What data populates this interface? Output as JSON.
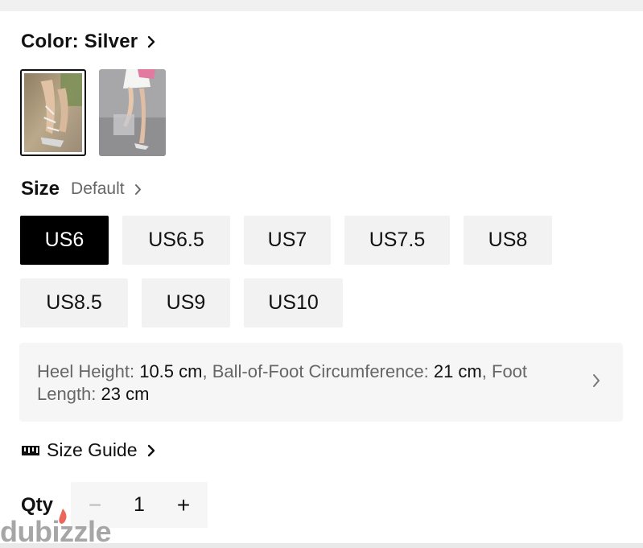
{
  "color": {
    "label": "Color:",
    "value": "Silver"
  },
  "thumbnails": [
    {
      "name": "silver-heel-photo-1",
      "selected": true
    },
    {
      "name": "silver-heel-photo-2",
      "selected": false
    }
  ],
  "size": {
    "label": "Size",
    "value": "Default",
    "options": [
      "US6",
      "US6.5",
      "US7",
      "US7.5",
      "US8",
      "US8.5",
      "US9",
      "US10"
    ],
    "selected": "US6"
  },
  "measurements": {
    "heel_label": "Heel Height:",
    "heel_value": "10.5 cm",
    "ball_label": "Ball-of-Foot Circumference:",
    "ball_value": "21 cm",
    "foot_label": "Foot Length:",
    "foot_value": "23 cm"
  },
  "size_guide": {
    "label": "Size Guide"
  },
  "qty": {
    "label": "Qty",
    "value": "1",
    "minus": "−",
    "plus": "+"
  },
  "watermark": {
    "text": "dubizzle"
  },
  "colors": {
    "selected_bg": "#000000",
    "option_bg": "#f2f2f2",
    "panel_bg": "#f6f6f6",
    "muted_text": "#666666"
  }
}
